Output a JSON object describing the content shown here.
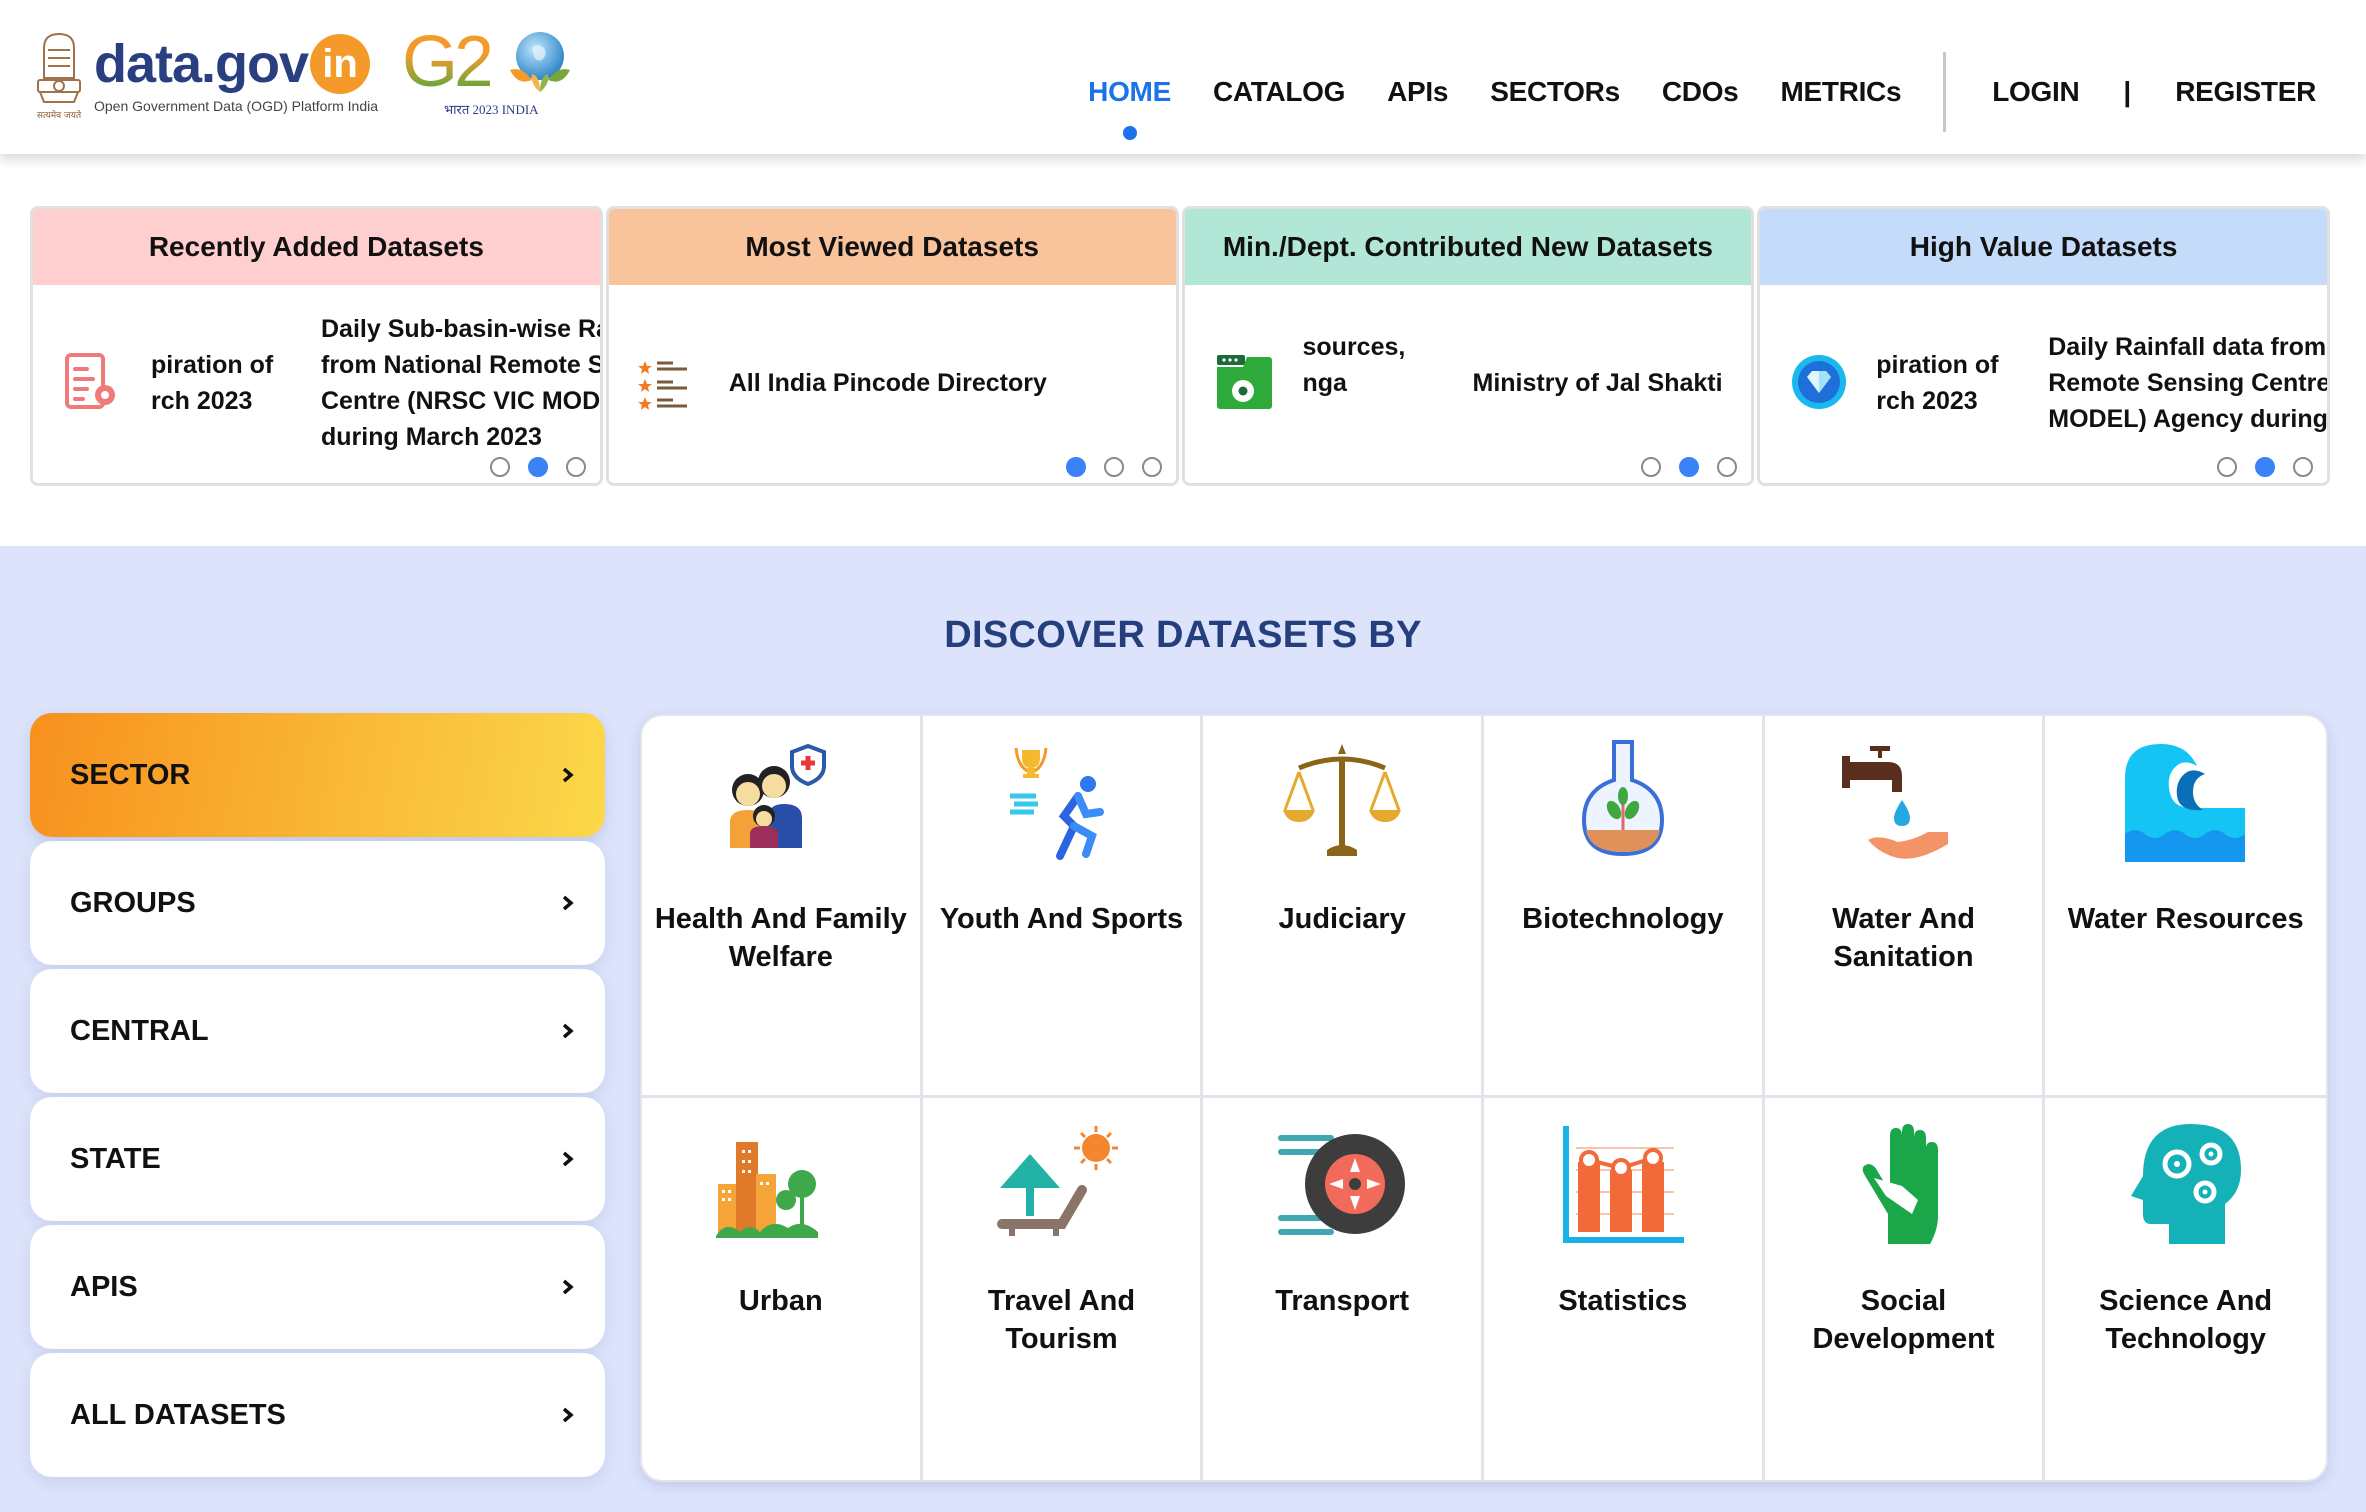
{
  "header": {
    "brand_name": "data.gov",
    "brand_suffix": "in",
    "brand_tagline": "Open Government Data (OGD) Platform India",
    "emblem_motto": "सत्यमेव जयते",
    "g20_text": "G2",
    "g20_subtitle": "भारत 2023 INDIA",
    "nav": [
      {
        "label": "HOME",
        "active": true
      },
      {
        "label": "CATALOG"
      },
      {
        "label": "APIs"
      },
      {
        "label": "SECTORs"
      },
      {
        "label": "CDOs"
      },
      {
        "label": "METRICs"
      }
    ],
    "login_label": "LOGIN",
    "separator": "|",
    "register_label": "REGISTER"
  },
  "cards": [
    {
      "title": "Recently Added Datasets",
      "header_color": "#fecfce",
      "icon": "document-gear-icon",
      "fragment_lines": [
        "piration of",
        "rch 2023"
      ],
      "text_lines": [
        "Daily Sub-basin-wise Ra",
        "from National Remote S",
        "Centre (NRSC VIC MODE",
        "during March 2023"
      ],
      "active_dot": 2,
      "dots": 3
    },
    {
      "title": "Most Viewed Datasets",
      "header_color": "#f9c49c",
      "icon": "star-list-icon",
      "fragment_lines": [],
      "text_lines": [
        "All India Pincode Directory"
      ],
      "active_dot": 1,
      "dots": 3
    },
    {
      "title": "Min./Dept. Contributed New Datasets",
      "header_color": "#b2e6d7",
      "icon": "folder-gear-icon",
      "fragment_lines": [
        "sources,",
        "nga"
      ],
      "text_lines": [
        "Ministry of Jal Shakti"
      ],
      "active_dot": 2,
      "dots": 3
    },
    {
      "title": "High Value Datasets",
      "header_color": "#c4dbfa",
      "icon": "diamond-badge-icon",
      "fragment_lines": [
        "piration of",
        "rch 2023"
      ],
      "text_lines": [
        "Daily Rainfall data from",
        "Remote Sensing Centre",
        "MODEL) Agency during N"
      ],
      "active_dot": 2,
      "dots": 3
    }
  ],
  "discover": {
    "title": "DISCOVER DATASETS BY",
    "tabs": [
      {
        "label": "SECTOR",
        "active": true
      },
      {
        "label": "GROUPS"
      },
      {
        "label": "CENTRAL"
      },
      {
        "label": "STATE"
      },
      {
        "label": "APIS"
      },
      {
        "label": "ALL DATASETS"
      }
    ],
    "sectors": [
      {
        "label": "Health And Family Welfare",
        "icon": "family-health-icon"
      },
      {
        "label": "Youth And Sports",
        "icon": "runner-trophy-icon"
      },
      {
        "label": "Judiciary",
        "icon": "scales-icon"
      },
      {
        "label": "Biotechnology",
        "icon": "flask-plant-icon"
      },
      {
        "label": "Water And Sanitation",
        "icon": "tap-hand-icon"
      },
      {
        "label": "Water Resources",
        "icon": "wave-icon"
      },
      {
        "label": "Urban",
        "icon": "city-icon"
      },
      {
        "label": "Travel And Tourism",
        "icon": "beach-umbrella-icon"
      },
      {
        "label": "Transport",
        "icon": "wheel-icon"
      },
      {
        "label": "Statistics",
        "icon": "bar-chart-icon"
      },
      {
        "label": "Social Development",
        "icon": "helping-hand-icon"
      },
      {
        "label": "Science And Technology",
        "icon": "head-gears-icon"
      }
    ]
  },
  "colors": {
    "nav_active": "#1a73e8",
    "discover_bg": "#dce3fb",
    "discover_title": "#253f7d",
    "dot_active": "#3b82f6",
    "brand_blue": "#2a3f80",
    "brand_orange": "#f39a2b"
  }
}
